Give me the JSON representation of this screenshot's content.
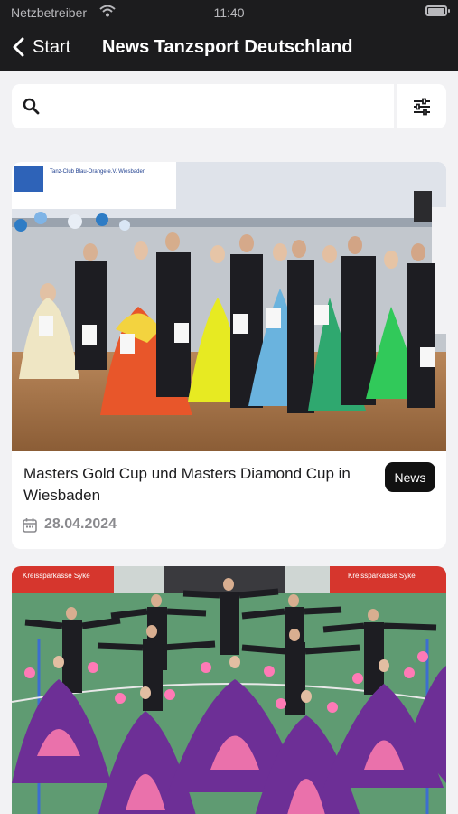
{
  "status_bar": {
    "carrier": "Netzbetreiber",
    "time": "11:40"
  },
  "nav": {
    "back_label": "Start",
    "title": "News Tanzsport Deutschland"
  },
  "search": {
    "placeholder": "",
    "value": ""
  },
  "feed": [
    {
      "title": "Masters Gold Cup und Masters Diamond Cup in Wiesbaden",
      "badge": "News",
      "date": "28.04.2024",
      "banner_text": "Tanz-Club Blau-Orange e.V. Wiesbaden"
    },
    {
      "banner_left": "Kreissparkasse Syke",
      "banner_right": "Kreissparkasse Syke"
    }
  ],
  "colors": {
    "nav_background": "#1c1c1e",
    "page_background": "#f2f2f4",
    "badge_background": "#111111"
  }
}
